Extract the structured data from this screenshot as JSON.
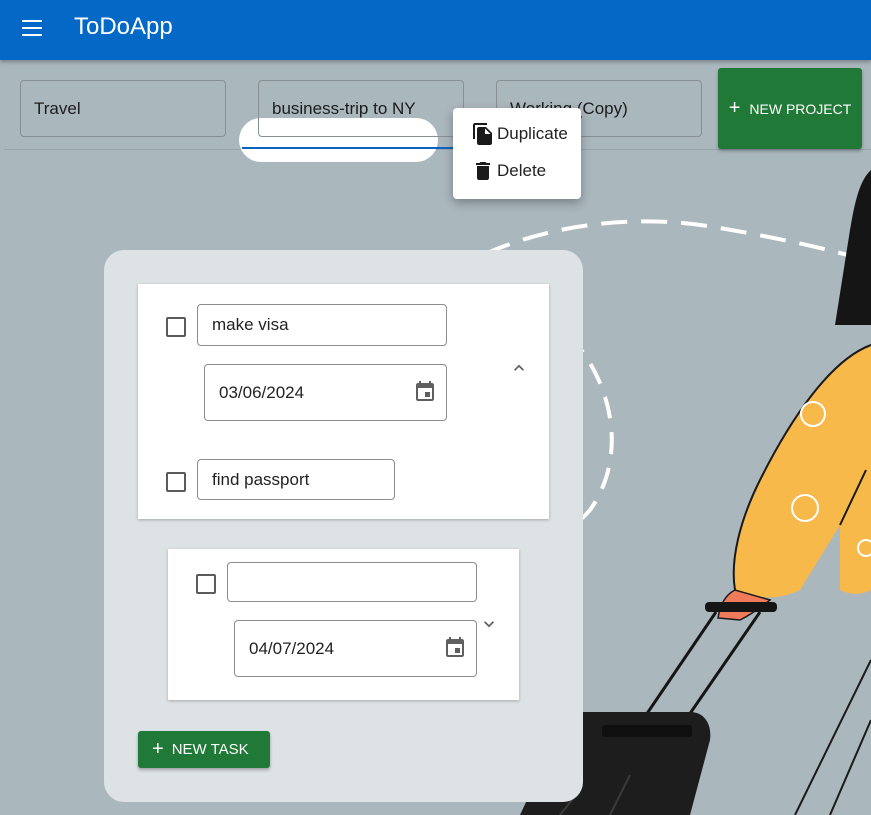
{
  "app": {
    "title": "ToDoApp"
  },
  "icons": {
    "menu": "menu-icon",
    "plus": "plus-icon",
    "duplicate": "copy-icon",
    "delete": "trash-icon",
    "calendar": "calendar-icon",
    "chevron_up": "chevron-up-icon",
    "chevron_down": "chevron-down-icon"
  },
  "projects": [
    {
      "label": "Travel"
    },
    {
      "label": "business-trip to NY",
      "active": true
    },
    {
      "label": "Working (Copy)"
    }
  ],
  "new_project_label": "NEW PROJECT",
  "context_menu": {
    "duplicate": "Duplicate",
    "delete": "Delete"
  },
  "task_groups": [
    {
      "title": "make visa",
      "date": "03/06/2024",
      "expanded": true,
      "subtasks": [
        {
          "title": "find passport",
          "checked": false
        }
      ],
      "checked": false
    },
    {
      "title": "",
      "date": "04/07/2024",
      "expanded": false,
      "checked": false
    }
  ],
  "new_task_label": "NEW TASK",
  "colors": {
    "appbar": "#0368c6",
    "accent_green": "#217937",
    "background": "#aab7bd",
    "card": "#dde2e5"
  }
}
